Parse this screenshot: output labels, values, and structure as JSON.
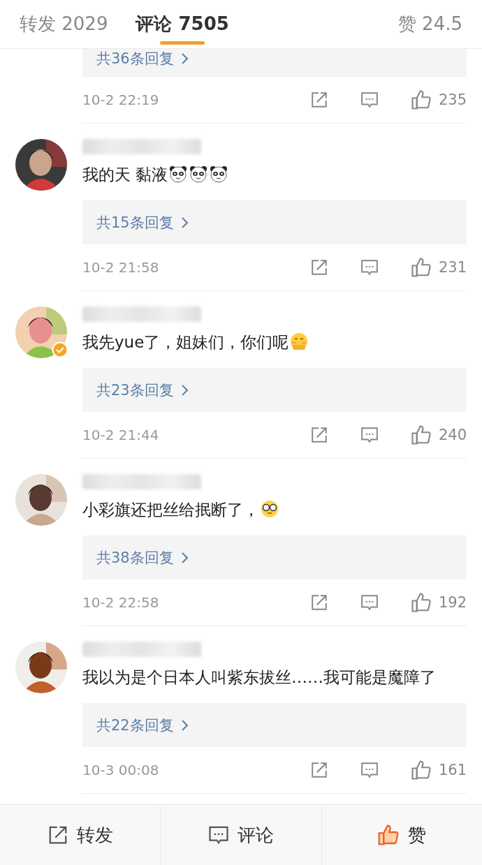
{
  "tabs": [
    {
      "label": "转发 2029",
      "selected": false
    },
    {
      "label": "评论 7505",
      "selected": true
    },
    {
      "label": "赞 24.5",
      "selected": false
    }
  ],
  "comments": [
    {
      "kind": "partial",
      "replies": "共36条回复",
      "time": "10-2 22:19",
      "likes": "235"
    },
    {
      "kind": "full",
      "verified": false,
      "text": "我的天 黏液",
      "emojis": [
        {
          "kind": "panda"
        },
        {
          "kind": "panda"
        },
        {
          "kind": "panda"
        }
      ],
      "replies": "共15条回复",
      "time": "10-2 21:58",
      "likes": "231"
    },
    {
      "kind": "full",
      "verified": true,
      "text": "我先yue了，姐妹们，你们呢",
      "emojis": [
        {
          "kind": "blush"
        }
      ],
      "replies": "共23条回复",
      "time": "10-2 21:44",
      "likes": "240"
    },
    {
      "kind": "full",
      "verified": false,
      "text": "小彩旗还把丝给抿断了，",
      "emojis": [
        {
          "kind": "glasses"
        }
      ],
      "replies": "共38条回复",
      "time": "10-2 22:58",
      "likes": "192"
    },
    {
      "kind": "full",
      "verified": false,
      "text": "我以为是个日本人叫紫东拔丝……我可能是魔障了",
      "replies": "共22条回复",
      "time": "10-3 00:08",
      "likes": "161"
    }
  ],
  "bottom_bar": [
    {
      "kind": "share",
      "label": "转发"
    },
    {
      "kind": "comment",
      "label": "评论"
    },
    {
      "kind": "like",
      "label": "赞",
      "liked": true
    }
  ]
}
